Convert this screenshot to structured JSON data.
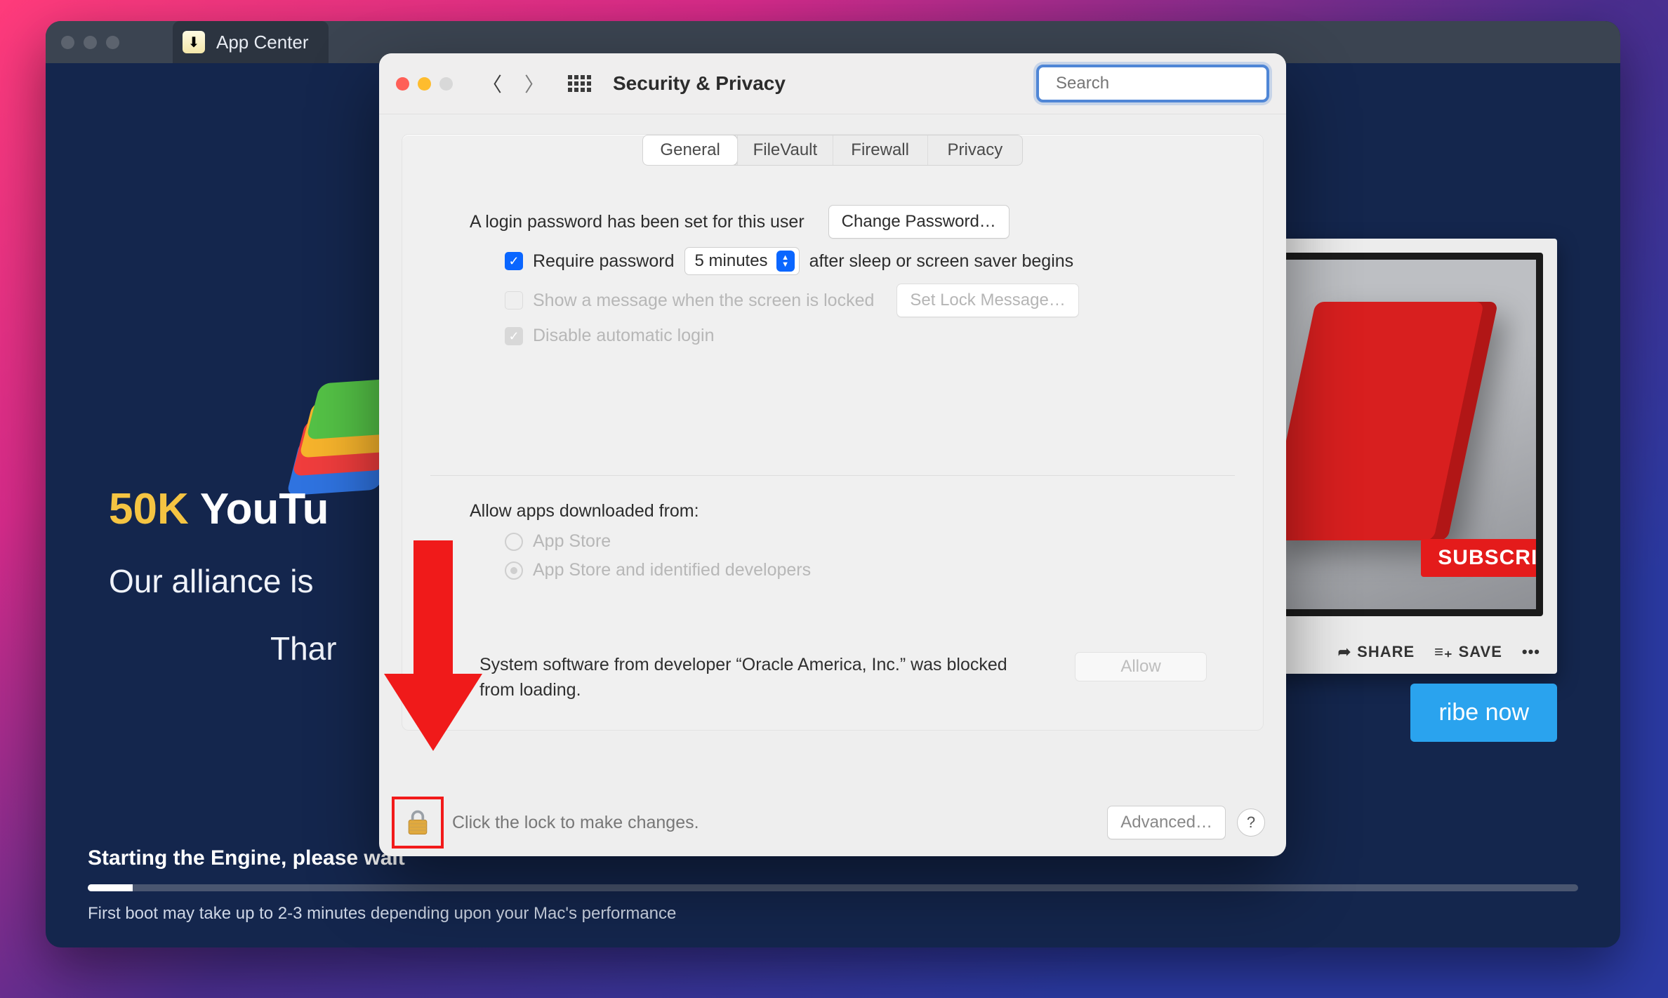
{
  "background": {
    "tab_label": "App Center",
    "heading_gold": "50K",
    "heading_rest_visible": " YouTu",
    "subline1_visible": "Our alliance is",
    "subline2_visible": "Thar",
    "subscribe_badge": "SUBSCRIBE",
    "share_label": "SHARE",
    "save_label": "SAVE",
    "more_label": "•••",
    "subscribe_btn_visible": "ribe now",
    "status_visible": "Starting the Engine, please wait",
    "hint": "First boot may take up to 2-3 minutes depending upon your Mac's performance"
  },
  "prefs": {
    "title": "Security & Privacy",
    "search_placeholder": "Search",
    "tabs": [
      "General",
      "FileVault",
      "Firewall",
      "Privacy"
    ],
    "active_tab_index": 0,
    "login_password_line": "A login password has been set for this user",
    "change_password_btn": "Change Password…",
    "require_password_label": "Require password",
    "require_password_after": "after sleep or screen saver begins",
    "require_password_delay": "5 minutes",
    "show_message_label": "Show a message when the screen is locked",
    "set_lock_message_btn": "Set Lock Message…",
    "disable_auto_login_label": "Disable automatic login",
    "allow_apps_title": "Allow apps downloaded from:",
    "allow_apps_opt1": "App Store",
    "allow_apps_opt2": "App Store and identified developers",
    "blocked_text": "System software from developer “Oracle America, Inc.” was blocked from loading.",
    "allow_btn": "Allow",
    "lock_text": "Click the lock to make changes.",
    "advanced_btn": "Advanced…",
    "help_label": "?"
  }
}
